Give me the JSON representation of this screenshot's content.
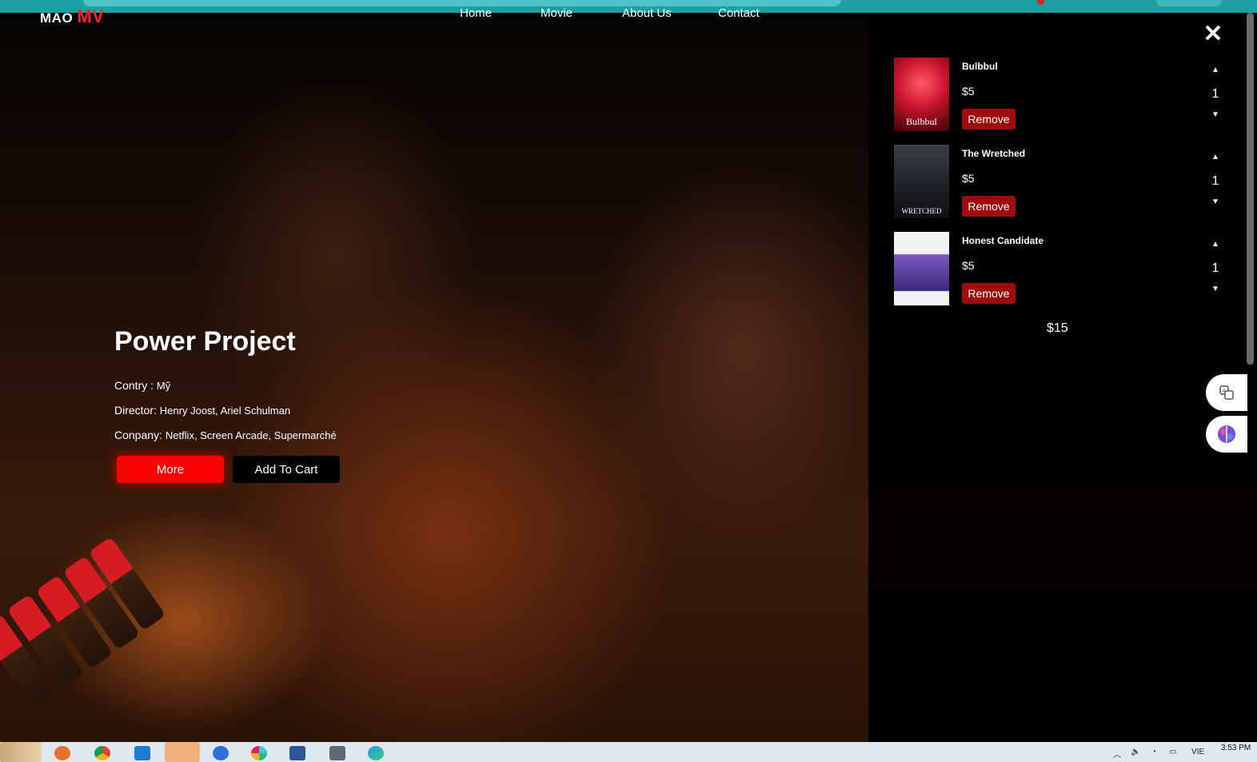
{
  "nav": {
    "logo_prefix": "MAO",
    "logo_mark": "MV",
    "links": [
      "Home",
      "Movie",
      "About Us",
      "Contact"
    ]
  },
  "hero": {
    "title": "Power Project",
    "country_label": "Contry : ",
    "country_value": "Mỹ",
    "director_label": "Director: ",
    "director_value": "Henry Joost, Ariel Schulman",
    "company_label": "Conpany: ",
    "company_value": "Netflix, Screen Arcade, Supermarché",
    "more_label": "More",
    "add_to_cart_label": "Add To Cart"
  },
  "cart": {
    "close_icon": "close-icon",
    "items": [
      {
        "name": "Bulbbul",
        "price": "$5",
        "qty": "1",
        "remove_label": "Remove",
        "poster_text": "Bulbbul",
        "poster_color": "#b81b2a"
      },
      {
        "name": "The Wretched",
        "price": "$5",
        "qty": "1",
        "remove_label": "Remove",
        "poster_text": "WRETCHED",
        "poster_color": "#2c3036"
      },
      {
        "name": "Honest Candidate",
        "price": "$5",
        "qty": "1",
        "remove_label": "Remove",
        "poster_text": "",
        "poster_color": "#4a3a8a"
      }
    ],
    "total": "$15"
  },
  "taskbar": {
    "clock": "3:53 PM",
    "lang": "VIE"
  },
  "colors": {
    "accent_red": "#ff0000",
    "remove_red": "#a00c0c",
    "teal_strip": "#1d9fa4"
  }
}
